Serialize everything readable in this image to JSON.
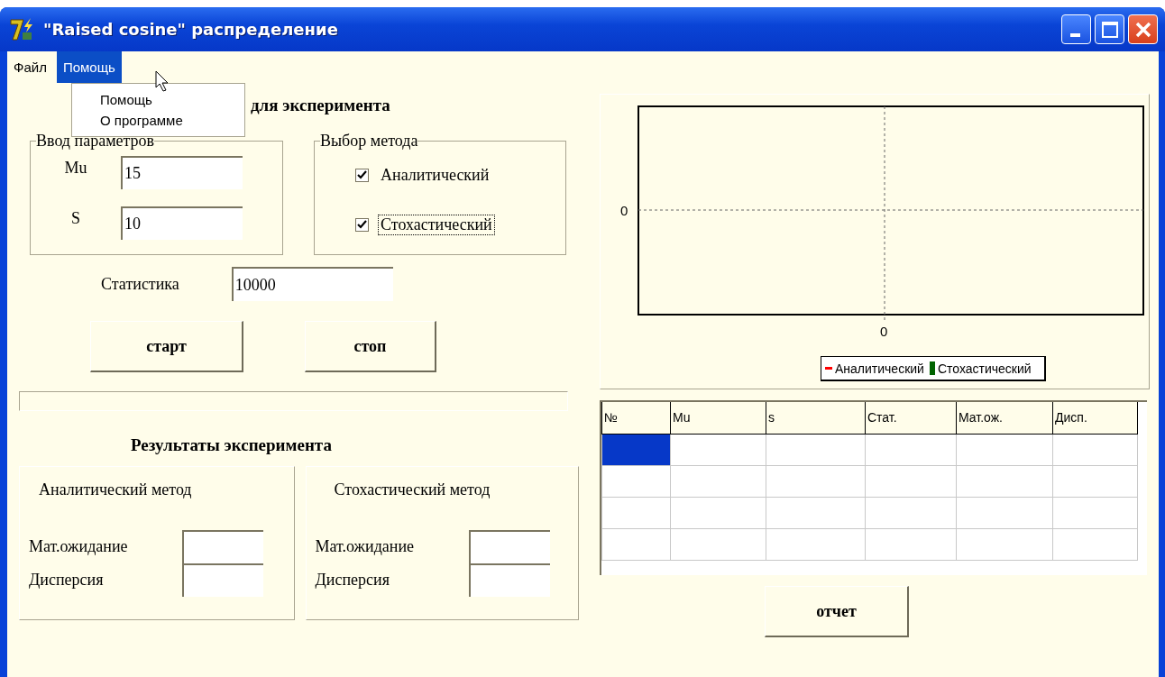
{
  "window": {
    "title": "\"Raised cosine\" распределение"
  },
  "menu": [
    {
      "label": "Файл",
      "selected": false
    },
    {
      "label": "Помощь",
      "selected": true
    }
  ],
  "dropdown": {
    "items": [
      "Помощь",
      "О программе"
    ]
  },
  "heading": "для эксперимента",
  "params": {
    "title": "Ввод параметров",
    "fields": [
      {
        "label": "Mu",
        "value": "15"
      },
      {
        "label": "S",
        "value": "10"
      }
    ]
  },
  "methods": {
    "title": "Выбор метода",
    "options": [
      {
        "label": "Аналитический",
        "checked": true,
        "focused": false
      },
      {
        "label": "Стохастический",
        "checked": true,
        "focused": true
      }
    ]
  },
  "statistics": {
    "label": "Статистика",
    "value": "10000"
  },
  "buttons": [
    "старт",
    "стоп"
  ],
  "results": {
    "title": "Результаты эксперимента",
    "panels": [
      {
        "title": "Аналитический метод",
        "fields": [
          {
            "label": "Мат.ожидание"
          },
          {
            "label": "Дисперсия"
          }
        ]
      },
      {
        "title": "Стохастический метод",
        "fields": [
          {
            "label": "Мат.ожидание"
          },
          {
            "label": "Дисперсия"
          }
        ]
      }
    ]
  },
  "chart": {
    "y_tick": "0",
    "x_tick": "0",
    "legend": [
      {
        "label": "Аналитический",
        "color": "#ff0000",
        "kind": "line"
      },
      {
        "label": "Стохастический",
        "color": "#006400",
        "kind": "bar"
      }
    ]
  },
  "table": {
    "columns": [
      "№",
      "Mu",
      "s",
      "Стат.",
      "Мат.ож.",
      "Дисп."
    ],
    "rows": [
      {
        "selected": true
      },
      {
        "selected": false
      },
      {
        "selected": false
      },
      {
        "selected": false
      }
    ]
  },
  "report_button": "отчет"
}
